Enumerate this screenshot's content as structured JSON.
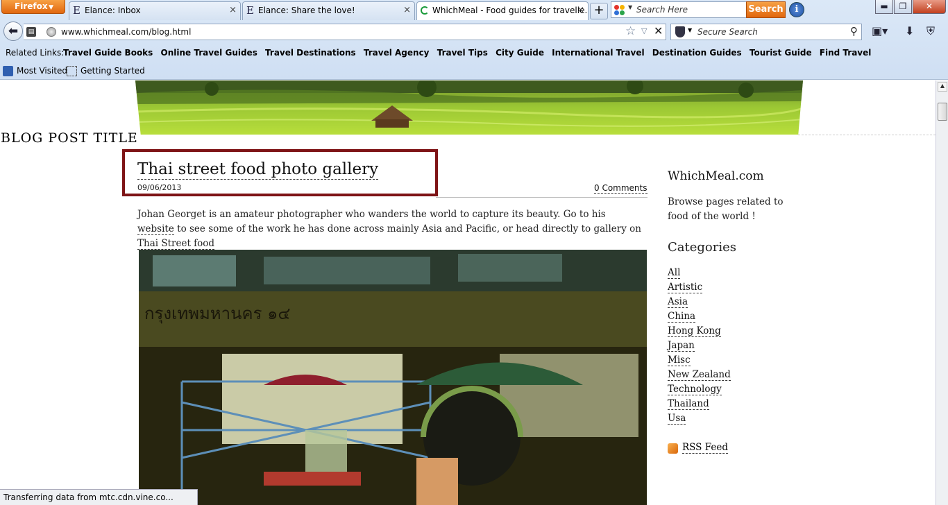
{
  "browser": {
    "firefox_menu": "Firefox",
    "tabs": [
      {
        "title": "Elance: Inbox",
        "icon": "elance-e-icon"
      },
      {
        "title": "Elance: Share the love!",
        "icon": "elance-e-icon"
      },
      {
        "title": "WhichMeal - Food guides for travelle...",
        "icon": "loading-spinner-icon"
      }
    ],
    "new_tab": "+",
    "search_top": {
      "placeholder": "Search Here",
      "button": "Search"
    },
    "url": "www.whichmeal.com/blog.html",
    "secure_search": {
      "placeholder": "Secure Search"
    },
    "related_links_label": "Related Links:",
    "related_links": [
      "Travel Guide Books",
      "Online Travel Guides",
      "Travel Destinations",
      "Travel Agency",
      "Travel Tips",
      "City Guide",
      "International Travel",
      "Destination Guides",
      "Tourist Guide",
      "Find Travel"
    ],
    "bookmarks": [
      "Most Visited",
      "Getting Started"
    ],
    "status_text": "Transferring data from mtc.cdn.vine.co..."
  },
  "page": {
    "blog_post_title_label": "BLOG POST TITLE",
    "post": {
      "title": "Thai street food photo gallery",
      "date": "09/06/2013",
      "comments": "0 Comments",
      "body_text_1": "Johan Georget is an amateur photographer who wanders the world to capture its beauty. Go  to his ",
      "body_link_1": "website",
      "body_text_2": " to see some of the work he has done across mainly Asia and Pacific, or head directly to  gallery on ",
      "body_link_2": "Thai Street food",
      "photo_sign_text": "กรุงเทพมหานคร ๑๔"
    },
    "sidebar": {
      "site_name": "WhichMeal.com",
      "description": "Browse pages related to food of the world !",
      "categories_heading": "Categories",
      "categories": [
        "All",
        "Artistic",
        "Asia",
        "China",
        "Hong Kong",
        "Japan",
        "Misc",
        "New Zealand",
        "Technology",
        "Thailand",
        "Usa"
      ],
      "rss": "RSS Feed"
    }
  }
}
